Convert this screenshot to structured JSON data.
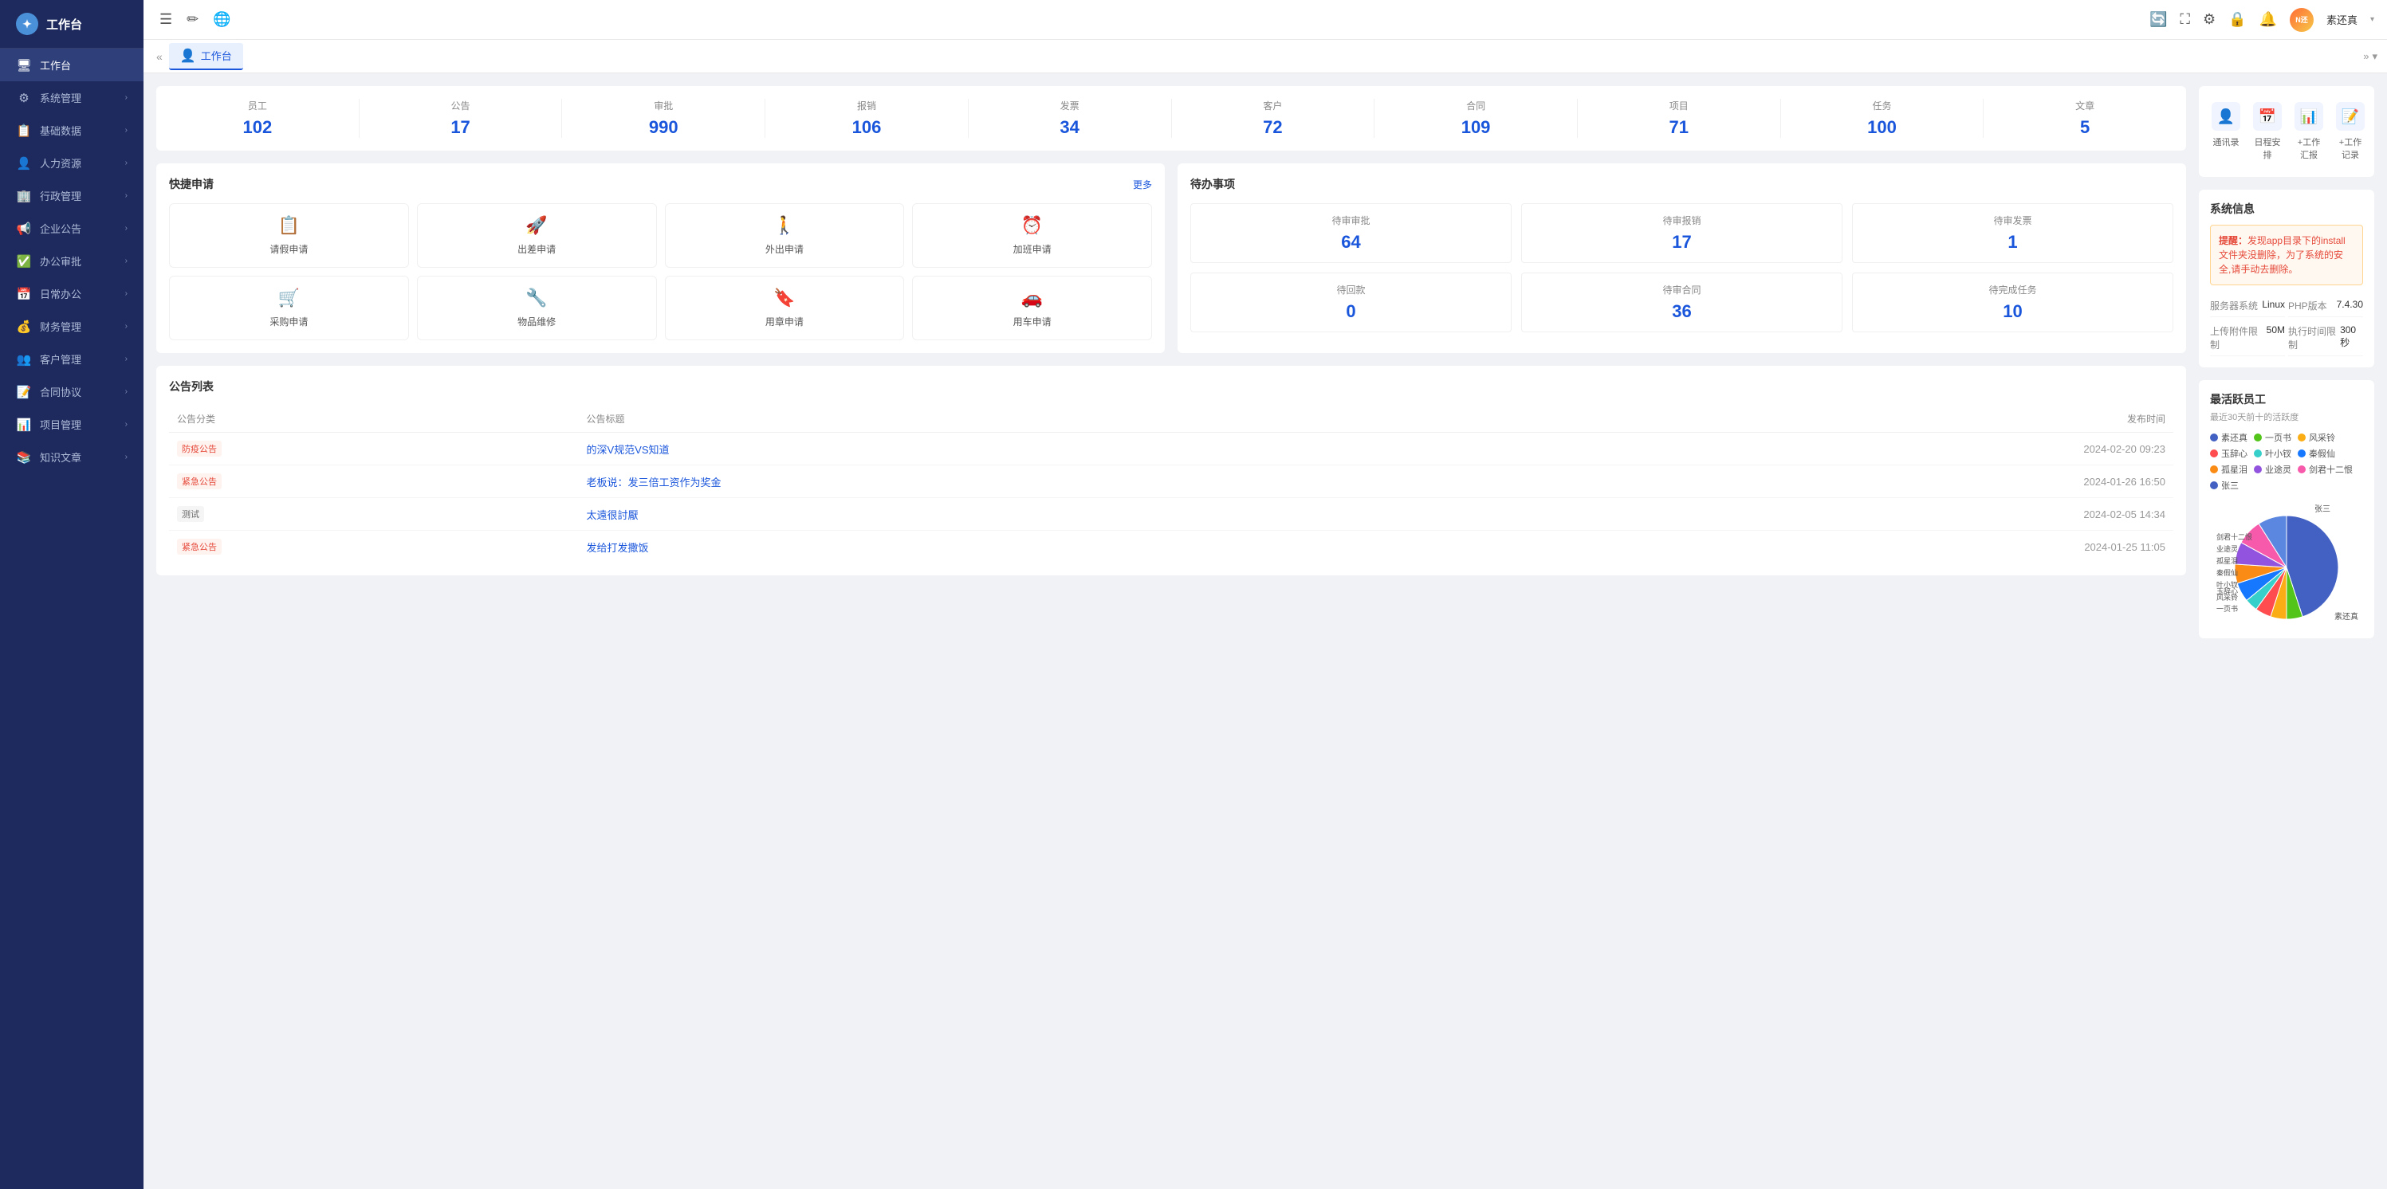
{
  "sidebar": {
    "logo_text": "工作台",
    "items": [
      {
        "id": "workbench",
        "label": "工作台",
        "icon": "🖥",
        "active": true
      },
      {
        "id": "system",
        "label": "系统管理",
        "icon": "⚙",
        "has_children": true
      },
      {
        "id": "basic",
        "label": "基础数据",
        "icon": "📋",
        "has_children": true
      },
      {
        "id": "hr",
        "label": "人力资源",
        "icon": "👤",
        "has_children": true
      },
      {
        "id": "admin",
        "label": "行政管理",
        "icon": "🏢",
        "has_children": true
      },
      {
        "id": "announce",
        "label": "企业公告",
        "icon": "📢",
        "has_children": true
      },
      {
        "id": "approval",
        "label": "办公审批",
        "icon": "✅",
        "has_children": true
      },
      {
        "id": "daily",
        "label": "日常办公",
        "icon": "📅",
        "has_children": true
      },
      {
        "id": "finance",
        "label": "财务管理",
        "icon": "💰",
        "has_children": true
      },
      {
        "id": "customer",
        "label": "客户管理",
        "icon": "👥",
        "has_children": true
      },
      {
        "id": "contract",
        "label": "合同协议",
        "icon": "📝",
        "has_children": true
      },
      {
        "id": "project",
        "label": "项目管理",
        "icon": "📊",
        "has_children": true
      },
      {
        "id": "knowledge",
        "label": "知识文章",
        "icon": "📚",
        "has_children": true
      }
    ]
  },
  "topbar": {
    "icons": [
      "☰",
      "✏",
      "🌐"
    ],
    "right_icons": [
      "🔄",
      "⛶",
      "⚙",
      "🔒",
      "🔔"
    ],
    "user": {
      "name": "素还真",
      "avatar_text": "N还"
    }
  },
  "tabs": {
    "left_chevron": "«",
    "right_chevron": "»",
    "items": [
      {
        "id": "workbench",
        "label": "工作台",
        "icon": "👤",
        "active": true
      }
    ]
  },
  "stats": {
    "items": [
      {
        "label": "员工",
        "value": "102"
      },
      {
        "label": "公告",
        "value": "17"
      },
      {
        "label": "审批",
        "value": "990"
      },
      {
        "label": "报销",
        "value": "106"
      },
      {
        "label": "发票",
        "value": "34"
      },
      {
        "label": "客户",
        "value": "72"
      },
      {
        "label": "合同",
        "value": "109"
      },
      {
        "label": "项目",
        "value": "71"
      },
      {
        "label": "任务",
        "value": "100"
      },
      {
        "label": "文章",
        "value": "5"
      }
    ]
  },
  "quick_apply": {
    "title": "快捷申请",
    "more_label": "更多",
    "items": [
      {
        "id": "leave",
        "label": "请假申请",
        "icon": "📋"
      },
      {
        "id": "business_trip",
        "label": "出差申请",
        "icon": "🚀"
      },
      {
        "id": "out",
        "label": "外出申请",
        "icon": "🚶"
      },
      {
        "id": "overtime",
        "label": "加班申请",
        "icon": "⏰"
      },
      {
        "id": "purchase",
        "label": "采购申请",
        "icon": "🛒"
      },
      {
        "id": "repair",
        "label": "物品维修",
        "icon": "🔧"
      },
      {
        "id": "seal",
        "label": "用章申请",
        "icon": "🔖"
      },
      {
        "id": "car",
        "label": "用车申请",
        "icon": "🚗"
      }
    ]
  },
  "pending": {
    "title": "待办事项",
    "items": [
      {
        "label": "待审审批",
        "value": "64"
      },
      {
        "label": "待审报销",
        "value": "17"
      },
      {
        "label": "待审发票",
        "value": "1"
      },
      {
        "label": "待回款",
        "value": "0"
      },
      {
        "label": "待审合同",
        "value": "36"
      },
      {
        "label": "待完成任务",
        "value": "10"
      }
    ]
  },
  "announcements": {
    "title": "公告列表",
    "columns": [
      "公告分类",
      "公告标题",
      "发布时间"
    ],
    "rows": [
      {
        "category": "防疫公告",
        "title": "的深V规范VS知道",
        "time": "2024-02-20 09:23",
        "tag_class": "tag-prevent"
      },
      {
        "category": "紧急公告",
        "title": "老板说：发三倍工资作为奖金",
        "time": "2024-01-26 16:50",
        "tag_class": "tag-urgent"
      },
      {
        "category": "测试",
        "title": "太遠很討厭",
        "time": "2024-02-05 14:34",
        "tag_class": "tag-test"
      },
      {
        "category": "紧急公告",
        "title": "发给打发撒饭",
        "time": "2024-01-25 11:05",
        "tag_class": "tag-urgent"
      }
    ]
  },
  "shortcuts": {
    "items": [
      {
        "id": "contacts",
        "label": "通讯录",
        "icon": "👤"
      },
      {
        "id": "schedule",
        "label": "日程安排",
        "icon": "📅"
      },
      {
        "id": "report",
        "label": "+工作汇报",
        "icon": "📊"
      },
      {
        "id": "log",
        "label": "+工作记录",
        "icon": "📝"
      }
    ]
  },
  "system_info": {
    "title": "系统信息",
    "alert": "提醒：发现app目录下的install文件夹没删除，为了系统的安全,请手动去删除。",
    "alert_prefix": "提醒：",
    "rows": [
      {
        "label": "服务器系统",
        "value": "Linux"
      },
      {
        "label": "PHP版本",
        "value": "7.4.30"
      },
      {
        "label": "上传附件限制",
        "value": "50M"
      },
      {
        "label": "执行时间限制",
        "value": "300秒"
      }
    ]
  },
  "active_employees": {
    "title": "最活跃员工",
    "subtitle": "最近30天前十的活跃度",
    "legend": [
      {
        "name": "素还真",
        "color": "#4361c2"
      },
      {
        "name": "一页书",
        "color": "#52c41a"
      },
      {
        "name": "风采铃",
        "color": "#faad14"
      },
      {
        "name": "玉辞心",
        "color": "#ff4d4f"
      },
      {
        "name": "叶小钗",
        "color": "#36cfc9"
      },
      {
        "name": "秦假仙",
        "color": "#1677ff"
      },
      {
        "name": "孤星泪",
        "color": "#fa8c16"
      },
      {
        "name": "业途灵",
        "color": "#9254de"
      },
      {
        "name": "剑君十二恨",
        "color": "#f759ab"
      },
      {
        "name": "张三",
        "color": "#4361c2"
      }
    ],
    "pie_labels": [
      {
        "name": "张三",
        "x": "78%",
        "y": "2%"
      },
      {
        "name": "剑君十二恨",
        "x": "30%",
        "y": "25%"
      },
      {
        "name": "业途灵",
        "x": "22%",
        "y": "35%"
      },
      {
        "name": "孤星泪",
        "x": "18%",
        "y": "45%"
      },
      {
        "name": "秦假仙",
        "x": "14%",
        "y": "55%"
      },
      {
        "name": "叶小钗",
        "x": "10%",
        "y": "62%"
      },
      {
        "name": "玉辞心",
        "x": "6%",
        "y": "70%"
      },
      {
        "name": "风采铃",
        "x": "2%",
        "y": "78%"
      },
      {
        "name": "一页书",
        "x": "2%",
        "y": "86%"
      },
      {
        "name": "素还真",
        "x": "82%",
        "y": "90%"
      }
    ],
    "pie_data": [
      {
        "name": "素还真",
        "color": "#4361c2",
        "percent": 45
      },
      {
        "name": "一页书",
        "color": "#52c41a",
        "percent": 5
      },
      {
        "name": "风采铃",
        "color": "#faad14",
        "percent": 5
      },
      {
        "name": "玉辞心",
        "color": "#ff4d4f",
        "percent": 5
      },
      {
        "name": "叶小钗",
        "color": "#36cfc9",
        "percent": 4
      },
      {
        "name": "秦假仙",
        "color": "#1677ff",
        "percent": 6
      },
      {
        "name": "孤星泪",
        "color": "#fa8c16",
        "percent": 6
      },
      {
        "name": "业途灵",
        "color": "#9254de",
        "percent": 7
      },
      {
        "name": "剑君十二恨",
        "color": "#f759ab",
        "percent": 8
      },
      {
        "name": "张三",
        "color": "#5b87e0",
        "percent": 9
      }
    ]
  }
}
